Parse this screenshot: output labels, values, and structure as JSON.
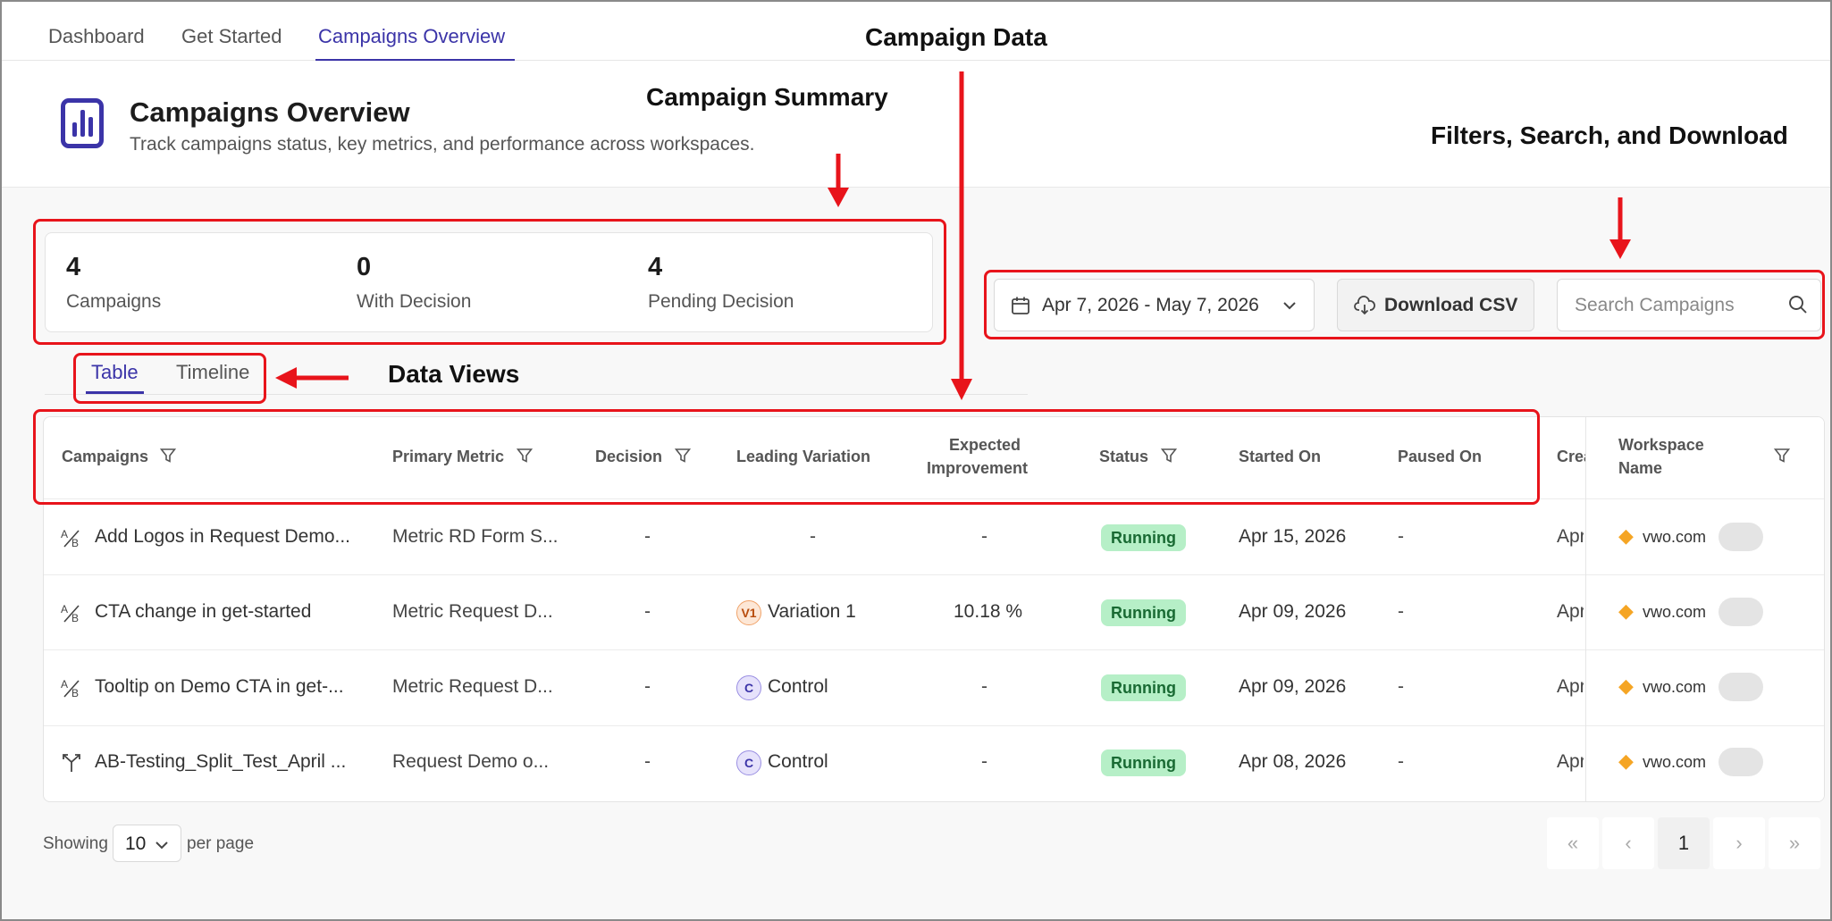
{
  "nav": {
    "tabs": [
      "Dashboard",
      "Get Started",
      "Campaigns Overview"
    ],
    "active_tab": "Campaigns Overview"
  },
  "header": {
    "title": "Campaigns Overview",
    "subtitle": "Track campaigns status, key metrics, and performance across workspaces.",
    "icon": "bar-chart-icon"
  },
  "summary": {
    "stats": [
      {
        "value": "4",
        "label": "Campaigns"
      },
      {
        "value": "0",
        "label": "With Decision"
      },
      {
        "value": "4",
        "label": "Pending Decision"
      }
    ]
  },
  "filters": {
    "date_range": "Apr 7, 2026 - May 7, 2026",
    "download_label": "Download CSV",
    "search_placeholder": "Search Campaigns"
  },
  "views": {
    "tabs": [
      "Table",
      "Timeline"
    ],
    "active": "Table"
  },
  "table": {
    "columns": {
      "campaigns": "Campaigns",
      "primary_metric": "Primary Metric",
      "decision": "Decision",
      "leading_variation": "Leading Variation",
      "expected_improvement_1": "Expected",
      "expected_improvement_2": "Improvement",
      "status": "Status",
      "started_on": "Started On",
      "paused_on": "Paused On",
      "created": "Crea",
      "workspace_1": "Workspace",
      "workspace_2": "Name"
    },
    "rows": [
      {
        "icon": "ab-test-icon",
        "name": "Add Logos in Request Demo...",
        "metric": "Metric RD Form S...",
        "decision": "-",
        "variation_badge": "",
        "variation": "-",
        "improvement": "-",
        "status": "Running",
        "started": "Apr 15, 2026",
        "paused": "-",
        "created": "Apr",
        "workspace": "vwo.com"
      },
      {
        "icon": "ab-test-icon",
        "name": "CTA change in get-started",
        "metric": "Metric Request D...",
        "decision": "-",
        "variation_badge": "V1",
        "variation": "Variation 1",
        "improvement": "10.18 %",
        "status": "Running",
        "started": "Apr 09, 2026",
        "paused": "-",
        "created": "Apr",
        "workspace": "vwo.com"
      },
      {
        "icon": "ab-test-icon",
        "name": "Tooltip on Demo CTA in get-...",
        "metric": "Metric Request D...",
        "decision": "-",
        "variation_badge": "C",
        "variation": "Control",
        "improvement": "-",
        "status": "Running",
        "started": "Apr 09, 2026",
        "paused": "-",
        "created": "Apr",
        "workspace": "vwo.com"
      },
      {
        "icon": "split-test-icon",
        "name": "AB-Testing_Split_Test_April ...",
        "metric": "Request Demo o...",
        "decision": "-",
        "variation_badge": "C",
        "variation": "Control",
        "improvement": "-",
        "status": "Running",
        "started": "Apr 08, 2026",
        "paused": "-",
        "created": "Apr",
        "workspace": "vwo.com"
      }
    ]
  },
  "pagination": {
    "showing_label": "Showing",
    "per_page_value": "10",
    "per_page_label": "per page",
    "current_page": "1"
  },
  "annotations": {
    "campaign_data": "Campaign Data",
    "campaign_summary": "Campaign Summary",
    "filters_search_download": "Filters, Search, and Download",
    "data_views": "Data Views"
  },
  "colors": {
    "accent": "#3b34a8",
    "annotation": "#e8141b",
    "running_bg": "#b6efc7",
    "gem": "#f5a524"
  }
}
